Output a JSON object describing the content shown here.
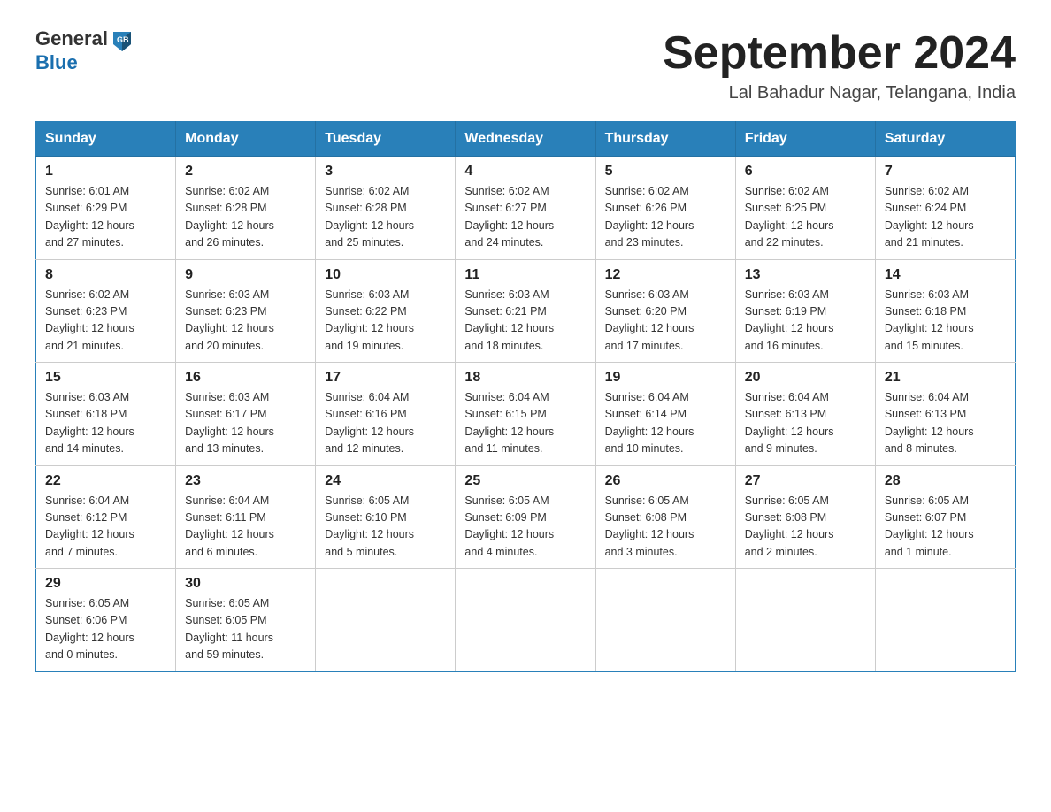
{
  "header": {
    "month_title": "September 2024",
    "location": "Lal Bahadur Nagar, Telangana, India",
    "logo_general": "General",
    "logo_blue": "Blue"
  },
  "days_of_week": [
    "Sunday",
    "Monday",
    "Tuesday",
    "Wednesday",
    "Thursday",
    "Friday",
    "Saturday"
  ],
  "weeks": [
    [
      {
        "day": "1",
        "sunrise": "6:01 AM",
        "sunset": "6:29 PM",
        "daylight": "12 hours and 27 minutes."
      },
      {
        "day": "2",
        "sunrise": "6:02 AM",
        "sunset": "6:28 PM",
        "daylight": "12 hours and 26 minutes."
      },
      {
        "day": "3",
        "sunrise": "6:02 AM",
        "sunset": "6:28 PM",
        "daylight": "12 hours and 25 minutes."
      },
      {
        "day": "4",
        "sunrise": "6:02 AM",
        "sunset": "6:27 PM",
        "daylight": "12 hours and 24 minutes."
      },
      {
        "day": "5",
        "sunrise": "6:02 AM",
        "sunset": "6:26 PM",
        "daylight": "12 hours and 23 minutes."
      },
      {
        "day": "6",
        "sunrise": "6:02 AM",
        "sunset": "6:25 PM",
        "daylight": "12 hours and 22 minutes."
      },
      {
        "day": "7",
        "sunrise": "6:02 AM",
        "sunset": "6:24 PM",
        "daylight": "12 hours and 21 minutes."
      }
    ],
    [
      {
        "day": "8",
        "sunrise": "6:02 AM",
        "sunset": "6:23 PM",
        "daylight": "12 hours and 21 minutes."
      },
      {
        "day": "9",
        "sunrise": "6:03 AM",
        "sunset": "6:23 PM",
        "daylight": "12 hours and 20 minutes."
      },
      {
        "day": "10",
        "sunrise": "6:03 AM",
        "sunset": "6:22 PM",
        "daylight": "12 hours and 19 minutes."
      },
      {
        "day": "11",
        "sunrise": "6:03 AM",
        "sunset": "6:21 PM",
        "daylight": "12 hours and 18 minutes."
      },
      {
        "day": "12",
        "sunrise": "6:03 AM",
        "sunset": "6:20 PM",
        "daylight": "12 hours and 17 minutes."
      },
      {
        "day": "13",
        "sunrise": "6:03 AM",
        "sunset": "6:19 PM",
        "daylight": "12 hours and 16 minutes."
      },
      {
        "day": "14",
        "sunrise": "6:03 AM",
        "sunset": "6:18 PM",
        "daylight": "12 hours and 15 minutes."
      }
    ],
    [
      {
        "day": "15",
        "sunrise": "6:03 AM",
        "sunset": "6:18 PM",
        "daylight": "12 hours and 14 minutes."
      },
      {
        "day": "16",
        "sunrise": "6:03 AM",
        "sunset": "6:17 PM",
        "daylight": "12 hours and 13 minutes."
      },
      {
        "day": "17",
        "sunrise": "6:04 AM",
        "sunset": "6:16 PM",
        "daylight": "12 hours and 12 minutes."
      },
      {
        "day": "18",
        "sunrise": "6:04 AM",
        "sunset": "6:15 PM",
        "daylight": "12 hours and 11 minutes."
      },
      {
        "day": "19",
        "sunrise": "6:04 AM",
        "sunset": "6:14 PM",
        "daylight": "12 hours and 10 minutes."
      },
      {
        "day": "20",
        "sunrise": "6:04 AM",
        "sunset": "6:13 PM",
        "daylight": "12 hours and 9 minutes."
      },
      {
        "day": "21",
        "sunrise": "6:04 AM",
        "sunset": "6:13 PM",
        "daylight": "12 hours and 8 minutes."
      }
    ],
    [
      {
        "day": "22",
        "sunrise": "6:04 AM",
        "sunset": "6:12 PM",
        "daylight": "12 hours and 7 minutes."
      },
      {
        "day": "23",
        "sunrise": "6:04 AM",
        "sunset": "6:11 PM",
        "daylight": "12 hours and 6 minutes."
      },
      {
        "day": "24",
        "sunrise": "6:05 AM",
        "sunset": "6:10 PM",
        "daylight": "12 hours and 5 minutes."
      },
      {
        "day": "25",
        "sunrise": "6:05 AM",
        "sunset": "6:09 PM",
        "daylight": "12 hours and 4 minutes."
      },
      {
        "day": "26",
        "sunrise": "6:05 AM",
        "sunset": "6:08 PM",
        "daylight": "12 hours and 3 minutes."
      },
      {
        "day": "27",
        "sunrise": "6:05 AM",
        "sunset": "6:08 PM",
        "daylight": "12 hours and 2 minutes."
      },
      {
        "day": "28",
        "sunrise": "6:05 AM",
        "sunset": "6:07 PM",
        "daylight": "12 hours and 1 minute."
      }
    ],
    [
      {
        "day": "29",
        "sunrise": "6:05 AM",
        "sunset": "6:06 PM",
        "daylight": "12 hours and 0 minutes."
      },
      {
        "day": "30",
        "sunrise": "6:05 AM",
        "sunset": "6:05 PM",
        "daylight": "11 hours and 59 minutes."
      },
      null,
      null,
      null,
      null,
      null
    ]
  ],
  "labels": {
    "sunrise": "Sunrise:",
    "sunset": "Sunset:",
    "daylight": "Daylight:"
  }
}
